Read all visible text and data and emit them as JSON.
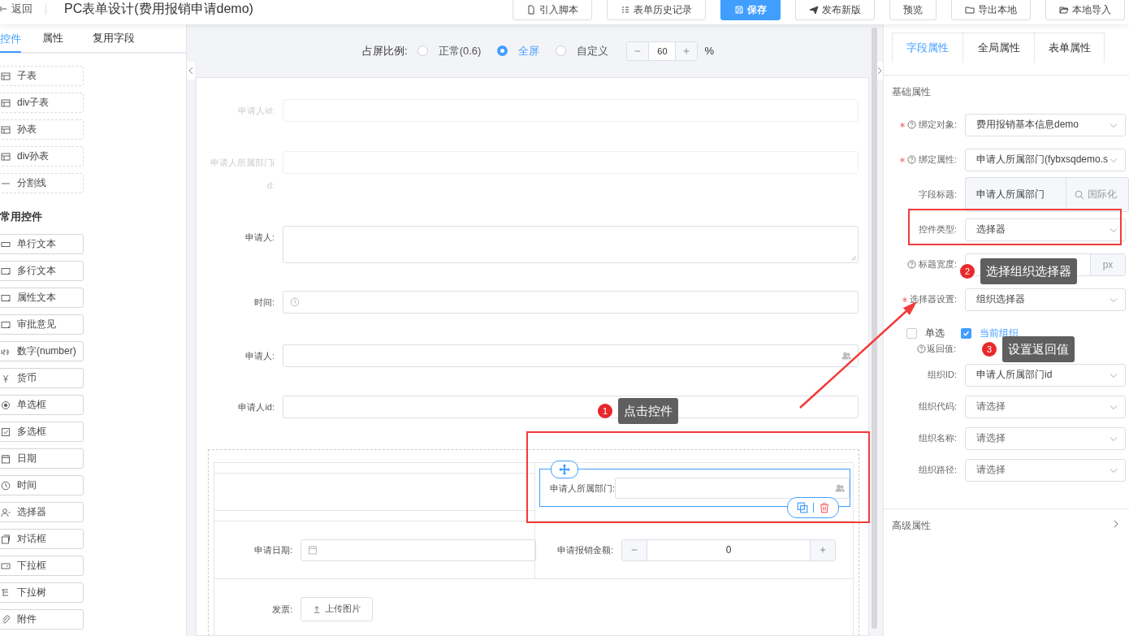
{
  "header": {
    "back": "返回",
    "title": "PC表单设计(费用报销申请demo)",
    "buttons": [
      {
        "label": "引入脚本",
        "kind": "script",
        "primary": false
      },
      {
        "label": "表单历史记录",
        "kind": "list",
        "primary": false
      },
      {
        "label": "保存",
        "kind": "save",
        "primary": true
      },
      {
        "label": "发布新版",
        "kind": "send",
        "primary": false
      },
      {
        "label": "预览",
        "kind": "none",
        "primary": false
      },
      {
        "label": "导出本地",
        "kind": "folder",
        "primary": false
      },
      {
        "label": "本地导入",
        "kind": "folder-open",
        "primary": false
      }
    ]
  },
  "left_panel": {
    "tabs": [
      {
        "label": "控件",
        "selected": true
      },
      {
        "label": "属性",
        "selected": false
      },
      {
        "label": "复用字段",
        "selected": false
      }
    ],
    "layout_items": [
      {
        "label": "子表",
        "kind": "table"
      },
      {
        "label": "div子表",
        "kind": "table"
      },
      {
        "label": "孙表",
        "kind": "table"
      },
      {
        "label": "div孙表",
        "kind": "table"
      },
      {
        "label": "分割线",
        "kind": "line"
      }
    ],
    "section_title": "常用控件",
    "common_items": [
      {
        "label": "单行文本",
        "kind": "input"
      },
      {
        "label": "多行文本",
        "kind": "textarea"
      },
      {
        "label": "属性文本",
        "kind": "textarea"
      },
      {
        "label": "审批意见",
        "kind": "textarea"
      },
      {
        "label": "数字(number)",
        "kind": "number"
      },
      {
        "label": "货币",
        "kind": "currency"
      },
      {
        "label": "单选框",
        "kind": "radio"
      },
      {
        "label": "多选框",
        "kind": "checkbox"
      },
      {
        "label": "日期",
        "kind": "date"
      },
      {
        "label": "时间",
        "kind": "time"
      },
      {
        "label": "选择器",
        "kind": "user"
      },
      {
        "label": "对话框",
        "kind": "dialog"
      },
      {
        "label": "下拉框",
        "kind": "select"
      },
      {
        "label": "下拉树",
        "kind": "tree"
      },
      {
        "label": "附件",
        "kind": "attachment"
      }
    ]
  },
  "canvas": {
    "ratio_label": "占屏比例:",
    "ratio_options": [
      {
        "label": "正常(0.6)",
        "selected": false
      },
      {
        "label": "全屏",
        "selected": true
      },
      {
        "label": "自定义",
        "selected": false
      }
    ],
    "ratio_value": "60",
    "ratio_unit": "%",
    "fields": [
      {
        "label": "申请人id:",
        "kind": "text",
        "hidden": true
      },
      {
        "label": "申请人所属部门id:",
        "kind": "text",
        "hidden": true
      },
      {
        "label": "申请人:",
        "kind": "textarea",
        "hidden": false
      },
      {
        "label": "时间:",
        "kind": "time",
        "hidden": false
      },
      {
        "label": "申请人:",
        "kind": "user",
        "hidden": false
      },
      {
        "label": "申请人id:",
        "kind": "text",
        "hidden": false
      }
    ],
    "grid": {
      "selected_field": {
        "label": "申请人所属部门:"
      },
      "date_field": {
        "label": "申请日期:"
      },
      "amount_field": {
        "label": "申请报销金额:",
        "value": "0"
      },
      "upload_field": {
        "label": "发票:",
        "button": "上传图片"
      }
    }
  },
  "right_panel": {
    "tabs": [
      {
        "label": "字段属性",
        "selected": true
      },
      {
        "label": "全局属性",
        "selected": false
      },
      {
        "label": "表单属性",
        "selected": false
      }
    ],
    "section_title": "基础属性",
    "rows": [
      {
        "label": "绑定对象:",
        "required": true,
        "help": true,
        "kind": "select",
        "value": "费用报销基本信息demo"
      },
      {
        "label": "绑定属性:",
        "required": true,
        "help": true,
        "kind": "select",
        "value": "申请人所属部门(fybxsqdemo.s"
      },
      {
        "label": "字段标题:",
        "required": false,
        "help": false,
        "kind": "addon",
        "value": "申请人所属部门",
        "addon": "国际化"
      },
      {
        "label": "控件类型:",
        "required": false,
        "help": false,
        "kind": "select",
        "value": "选择器"
      },
      {
        "label": "标题宽度:",
        "required": false,
        "help": true,
        "kind": "unit",
        "unit": "px"
      },
      {
        "label": "选择器设置:",
        "required": true,
        "help": false,
        "kind": "select",
        "value": "组织选择器"
      }
    ],
    "checkboxes": [
      {
        "label": "单选",
        "checked": false
      },
      {
        "label": "当前组织",
        "checked": true
      }
    ],
    "return_label": "返回值:",
    "return_rows": [
      {
        "label": "组织ID:",
        "value": "申请人所属部门id"
      },
      {
        "label": "组织代码:",
        "placeholder": "请选择"
      },
      {
        "label": "组织名称:",
        "placeholder": "请选择"
      },
      {
        "label": "组织路径:",
        "placeholder": "请选择"
      }
    ],
    "advanced_title": "高级属性"
  },
  "annotations": [
    {
      "number": "1",
      "text": "点击控件"
    },
    {
      "number": "2",
      "text": "选择组织选择器"
    },
    {
      "number": "3",
      "text": "设置返回值"
    }
  ]
}
